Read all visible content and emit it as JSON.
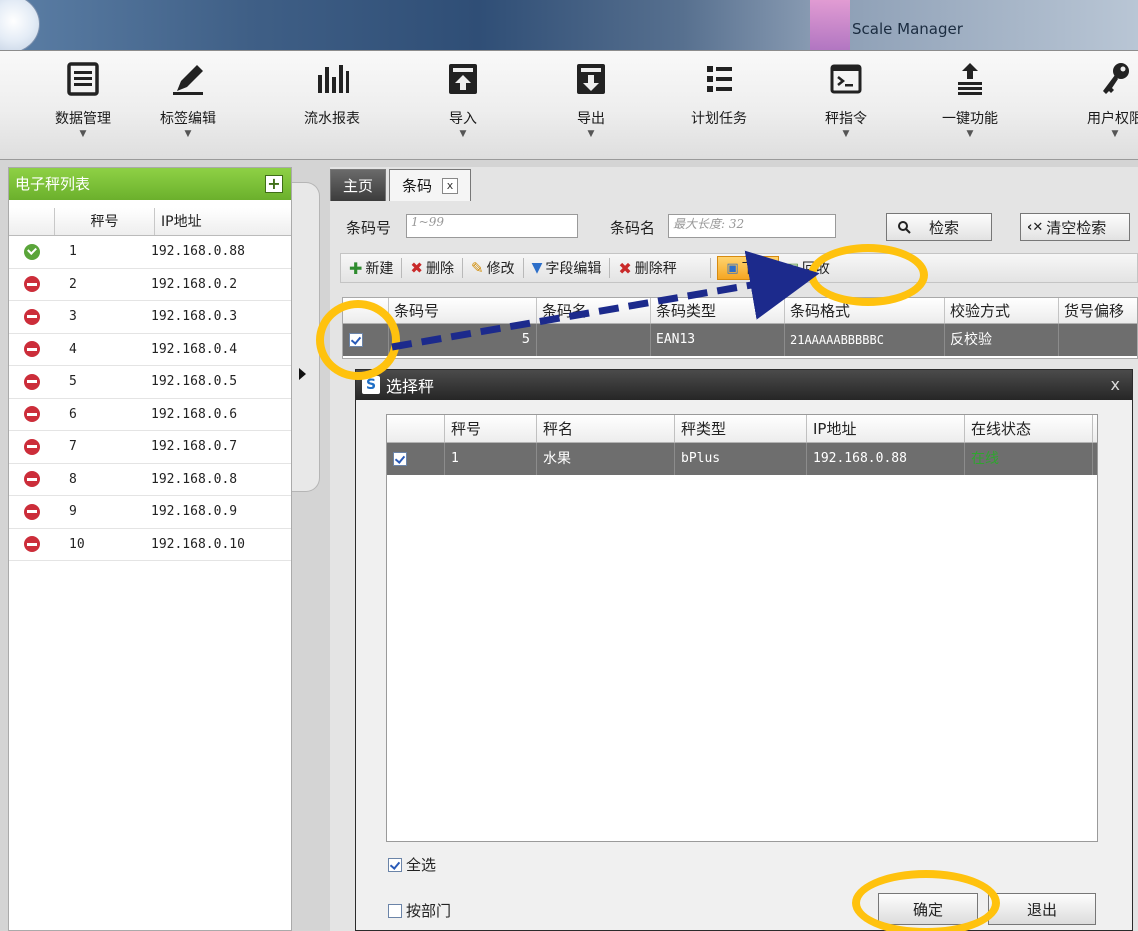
{
  "window": {
    "title": "Scale Manager"
  },
  "ribbon": {
    "items": [
      {
        "label": "数据管理",
        "icon": "database-icon",
        "has_dropdown": true
      },
      {
        "label": "标签编辑",
        "icon": "pen-icon",
        "has_dropdown": true
      },
      {
        "label": "流水报表",
        "icon": "bar-chart-icon",
        "has_dropdown": false
      },
      {
        "label": "导入",
        "icon": "import-icon",
        "has_dropdown": true
      },
      {
        "label": "导出",
        "icon": "export-icon",
        "has_dropdown": true
      },
      {
        "label": "计划任务",
        "icon": "task-list-icon",
        "has_dropdown": false
      },
      {
        "label": "秤指令",
        "icon": "terminal-icon",
        "has_dropdown": true
      },
      {
        "label": "一键功能",
        "icon": "upload-stack-icon",
        "has_dropdown": true
      },
      {
        "label": "用户权限",
        "icon": "key-icon",
        "has_dropdown": true
      }
    ]
  },
  "scale_list": {
    "title": "电子秤列表",
    "col_number": "秤号",
    "col_ip": "IP地址",
    "rows": [
      {
        "status": "online",
        "number": "1",
        "ip": "192.168.0.88"
      },
      {
        "status": "offline",
        "number": "2",
        "ip": "192.168.0.2"
      },
      {
        "status": "offline",
        "number": "3",
        "ip": "192.168.0.3"
      },
      {
        "status": "offline",
        "number": "4",
        "ip": "192.168.0.4"
      },
      {
        "status": "offline",
        "number": "5",
        "ip": "192.168.0.5"
      },
      {
        "status": "offline",
        "number": "6",
        "ip": "192.168.0.6"
      },
      {
        "status": "offline",
        "number": "7",
        "ip": "192.168.0.7"
      },
      {
        "status": "offline",
        "number": "8",
        "ip": "192.168.0.8"
      },
      {
        "status": "offline",
        "number": "9",
        "ip": "192.168.0.9"
      },
      {
        "status": "offline",
        "number": "10",
        "ip": "192.168.0.10"
      }
    ]
  },
  "tabs": {
    "home": "主页",
    "barcode": "条码",
    "close": "x"
  },
  "search": {
    "code_label": "条码号",
    "code_placeholder": "1~99",
    "name_label": "条码名",
    "name_placeholder": "最大长度: 32",
    "search_button": "检索",
    "clear_button": "清空检索"
  },
  "toolbar": {
    "new": "新建",
    "delete": "删除",
    "edit": "修改",
    "field_edit": "字段编辑",
    "delete_scale": "删除秤",
    "send": "下发",
    "recycle": "回收"
  },
  "barcode_grid": {
    "headers": [
      "条码号",
      "条码名",
      "条码类型",
      "条码格式",
      "校验方式",
      "货号偏移"
    ],
    "rows": [
      {
        "checked": true,
        "code": "5",
        "name": "",
        "type": "EAN13",
        "format": "21AAAAABBBBBC",
        "check": "反校验"
      }
    ]
  },
  "dialog": {
    "title": "选择秤",
    "close": "x",
    "headers": [
      "秤号",
      "秤名",
      "秤类型",
      "IP地址",
      "在线状态"
    ],
    "rows": [
      {
        "checked": true,
        "number": "1",
        "name": "水果",
        "type": "bPlus",
        "ip": "192.168.0.88",
        "state": "在线"
      }
    ],
    "select_all": "全选",
    "by_department": "按部门",
    "ok": "确定",
    "exit": "退出"
  },
  "colors": {
    "panel_header": "#6bb02c",
    "online": "#5aa53a",
    "offline": "#cc2d3a",
    "highlight_ring": "#ffc20e",
    "arrow": "#1c2a8c",
    "online_text": "#2fa52f"
  }
}
